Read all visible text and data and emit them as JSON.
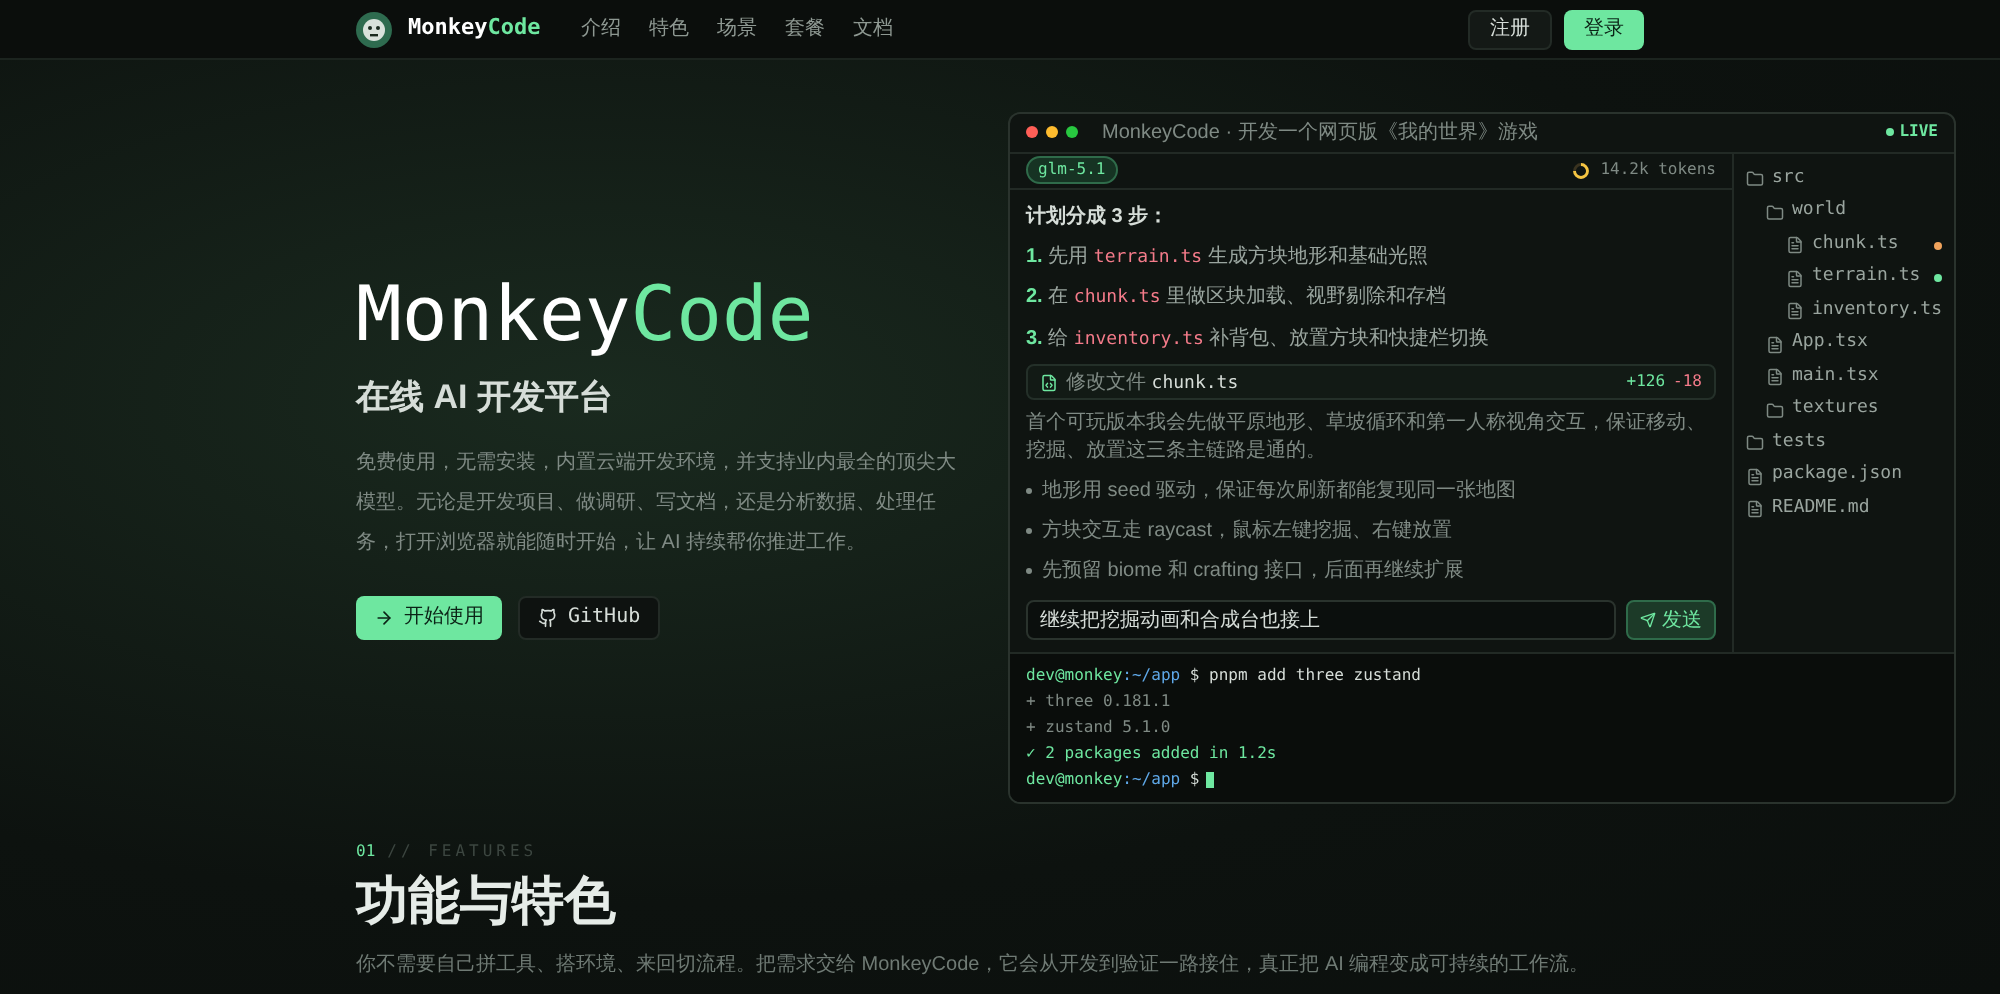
{
  "nav": {
    "brand": [
      {
        "text": "Monkey",
        "accent": false
      },
      {
        "text": "Code",
        "accent": true
      }
    ],
    "links": [
      "介绍",
      "特色",
      "场景",
      "套餐",
      "文档"
    ],
    "register": "注册",
    "login": "登录"
  },
  "hero": {
    "title": [
      {
        "text": "Monkey",
        "accent": false
      },
      {
        "text": "Code",
        "accent": true
      }
    ],
    "subtitle": "在线 AI 开发平台",
    "description": "免费使用，无需安装，内置云端开发环境，并支持业内最全的顶尖大模型。无论是开发项目、做调研、写文档，还是分析数据、处理任务，打开浏览器就能随时开始，让 AI 持续帮你推进工作。",
    "primary": "开始使用",
    "secondary": "GitHub"
  },
  "demo": {
    "title": "MonkeyCode · 开发一个网页版《我的世界》游戏",
    "live": "LIVE",
    "model": "glm-5.1",
    "tokens": "14.2k tokens",
    "plan_title": "计划分成 3 步：",
    "steps": [
      {
        "num": "1.",
        "pre": "先用",
        "file": "terrain.ts",
        "post": "生成方块地形和基础光照"
      },
      {
        "num": "2.",
        "pre": "在",
        "file": "chunk.ts",
        "post": "里做区块加载、视野剔除和存档"
      },
      {
        "num": "3.",
        "pre": "给",
        "file": "inventory.ts",
        "post": "补背包、放置方块和快捷栏切换"
      }
    ],
    "edit": {
      "label": "修改文件",
      "file": "chunk.ts",
      "added": "+126",
      "removed": "-18"
    },
    "paragraph": "首个可玩版本我会先做平原地形、草坡循环和第一人称视角交互，保证移动、挖掘、放置这三条主链路是通的。",
    "bullets": [
      "地形用 seed 驱动，保证每次刷新都能复现同一张地图",
      "方块交互走 raycast，鼠标左键挖掘、右键放置",
      "先预留 biome 和 crafting 接口，后面再继续扩展"
    ],
    "input": "继续把挖掘动画和合成台也接上",
    "send": "发送",
    "tree": [
      {
        "kind": "folder",
        "name": "src",
        "children": [
          {
            "kind": "folder",
            "name": "world",
            "children": [
              {
                "kind": "file",
                "name": "chunk.ts",
                "color": "#f0a35c"
              },
              {
                "kind": "file",
                "name": "terrain.ts",
                "color": "#6ee7a0"
              },
              {
                "kind": "file",
                "name": "inventory.ts"
              }
            ]
          },
          {
            "kind": "file",
            "name": "App.tsx"
          },
          {
            "kind": "file",
            "name": "main.tsx"
          },
          {
            "kind": "folder",
            "name": "textures"
          }
        ]
      },
      {
        "kind": "folder",
        "name": "tests"
      },
      {
        "kind": "file",
        "name": "package.json"
      },
      {
        "kind": "file",
        "name": "README.md"
      }
    ],
    "terminal": [
      {
        "kind": "prompt",
        "prompt": "dev@monkey",
        "path": ":~/app",
        "cmd": "$ pnpm add three zustand"
      },
      {
        "kind": "output",
        "text": "+ three 0.181.1"
      },
      {
        "kind": "output",
        "text": "+ zustand 5.1.0"
      },
      {
        "kind": "success",
        "text": "✓ 2 packages added in 1.2s"
      },
      {
        "kind": "cursor",
        "prompt": "dev@monkey",
        "path": ":~/app",
        "cmd": "$"
      }
    ]
  },
  "features": {
    "index": "01",
    "tag": "// FEATURES",
    "title": "功能与特色",
    "description": "你不需要自己拼工具、搭环境、来回切流程。把需求交给 MonkeyCode，它会从开发到验证一路接住，真正把 AI 编程变成可持续的工作流。"
  }
}
